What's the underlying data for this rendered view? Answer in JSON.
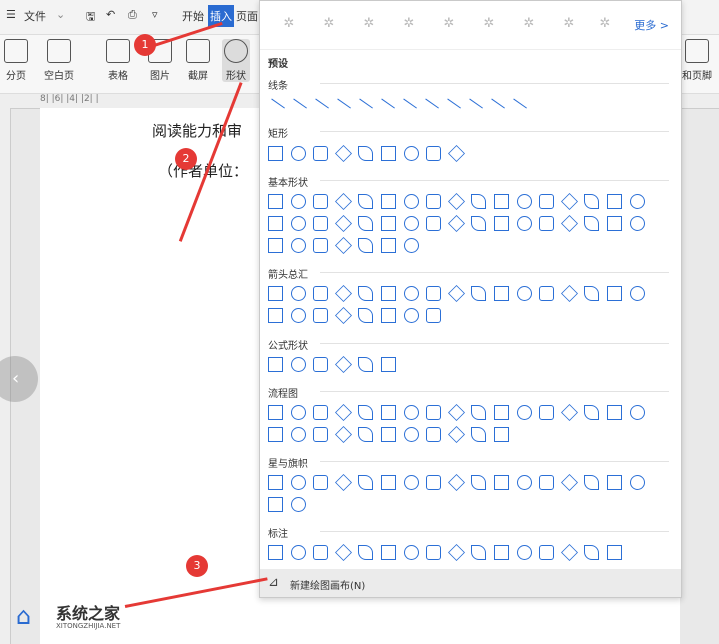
{
  "menu": {
    "file": "文件",
    "start": "开始",
    "insert": "插入",
    "page": "页面"
  },
  "ribbon": {
    "split": "分页",
    "blank": "空白页",
    "table": "表格",
    "picture": "图片",
    "screenshot": "截屏",
    "shape": "形状",
    "header_footer": "和页脚"
  },
  "ruler": {
    "marks": "8| |6| |4| |2| |"
  },
  "doc": {
    "line1": "阅读能力和审",
    "line2": "（作者单位："
  },
  "panel": {
    "more": "更多 >",
    "preset": "预设",
    "sections": [
      "线条",
      "矩形",
      "基本形状",
      "箭头总汇",
      "公式形状",
      "流程图",
      "星与旗帜",
      "标注"
    ],
    "new_canvas": "新建绘图画布(N)"
  },
  "badges": [
    "1",
    "2",
    "3"
  ],
  "watermark": {
    "name": "系统之家",
    "url": "XITONGZHIJIA.NET"
  },
  "colors": {
    "shape": "#2b6fd6",
    "badge": "#e53935"
  }
}
